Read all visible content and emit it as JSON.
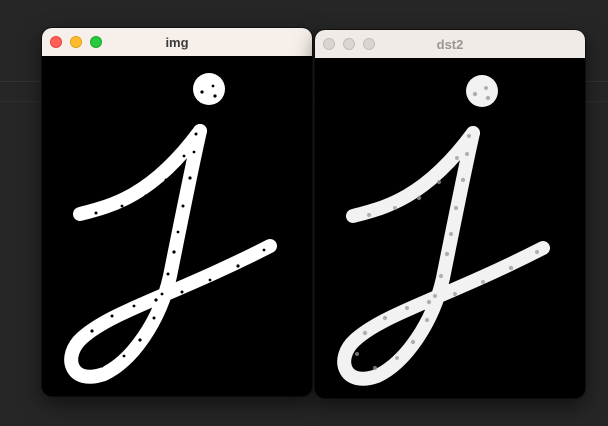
{
  "windows": [
    {
      "id": "img",
      "title": "img",
      "active": true,
      "controls": [
        "close",
        "minimize",
        "zoom"
      ]
    },
    {
      "id": "dst2",
      "title": "dst2",
      "active": false,
      "controls": [
        "close",
        "minimize",
        "zoom"
      ]
    }
  ],
  "colors": {
    "desktop": "#262626",
    "stroke": "#ffffff",
    "canvas": "#000000",
    "noise": "#000000",
    "blur_noise": "#9a9a9a"
  },
  "icons": {
    "close": "traffic-light-close-icon",
    "minimize": "traffic-light-minimize-icon",
    "zoom": "traffic-light-zoom-icon"
  }
}
